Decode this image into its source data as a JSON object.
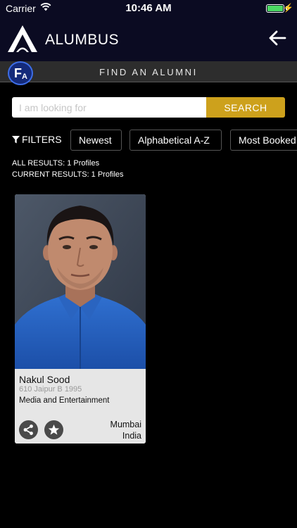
{
  "status_bar": {
    "carrier": "Carrier",
    "time": "10:46 AM",
    "battery_level": 1.0
  },
  "header": {
    "app_title": "ALUMBUS",
    "logo_icon": "alumbus-logo-icon",
    "back_icon": "arrow-left-icon"
  },
  "section": {
    "title": "FIND AN ALUMNI",
    "badge_letter_big": "F",
    "badge_letter_small": "A"
  },
  "search": {
    "placeholder": "I am looking for",
    "value": "",
    "button_label": "SEARCH"
  },
  "filters": {
    "label": "FILTERS",
    "chips": [
      "Newest",
      "Alphabetical A-Z",
      "Most Booked"
    ]
  },
  "results": {
    "all": "ALL RESULTS: 1 Profiles",
    "current": "CURRENT RESULTS: 1 Profiles"
  },
  "profiles": [
    {
      "name": "Nakul Sood",
      "batch": "610 Jaipur B 1995",
      "industry": "Media and Entertainment",
      "city": "Mumbai",
      "country": "India"
    }
  ],
  "colors": {
    "header_bg": "#0b0b22",
    "band_bg": "#2d2d2d",
    "accent": "#cda11c",
    "badge_blue": "#142a7a",
    "card_bg": "#e6e6e6",
    "battery": "#4cd964"
  }
}
